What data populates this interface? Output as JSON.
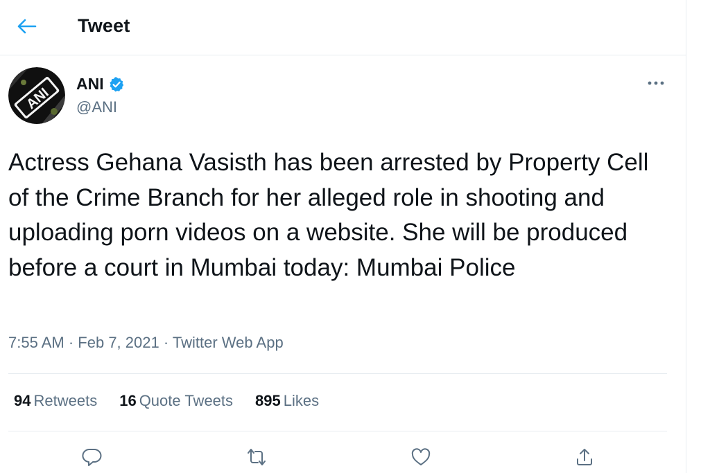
{
  "header": {
    "title": "Tweet",
    "back_icon": "arrow-left-icon"
  },
  "author": {
    "display_name": "ANI",
    "handle": "@ANI",
    "verified": true,
    "avatar_text": "ANI"
  },
  "tweet": {
    "text": "Actress Gehana Vasisth has been arrested by Property Cell of the Crime Branch for her alleged role in shooting and uploading porn videos on a website. She will be produced before a court in Mumbai today: Mumbai Police",
    "time": "7:55 AM",
    "date": "Feb 7, 2021",
    "source": "Twitter Web App",
    "separator": "·"
  },
  "stats": {
    "retweets_count": "94",
    "retweets_label": "Retweets",
    "quotes_count": "16",
    "quotes_label": "Quote Tweets",
    "likes_count": "895",
    "likes_label": "Likes"
  },
  "actions": [
    "reply-icon",
    "retweet-icon",
    "like-icon",
    "share-icon"
  ],
  "colors": {
    "accent": "#1da1f2",
    "text": "#0f1419",
    "secondary": "#5b7083",
    "border": "#e6ecf0"
  }
}
